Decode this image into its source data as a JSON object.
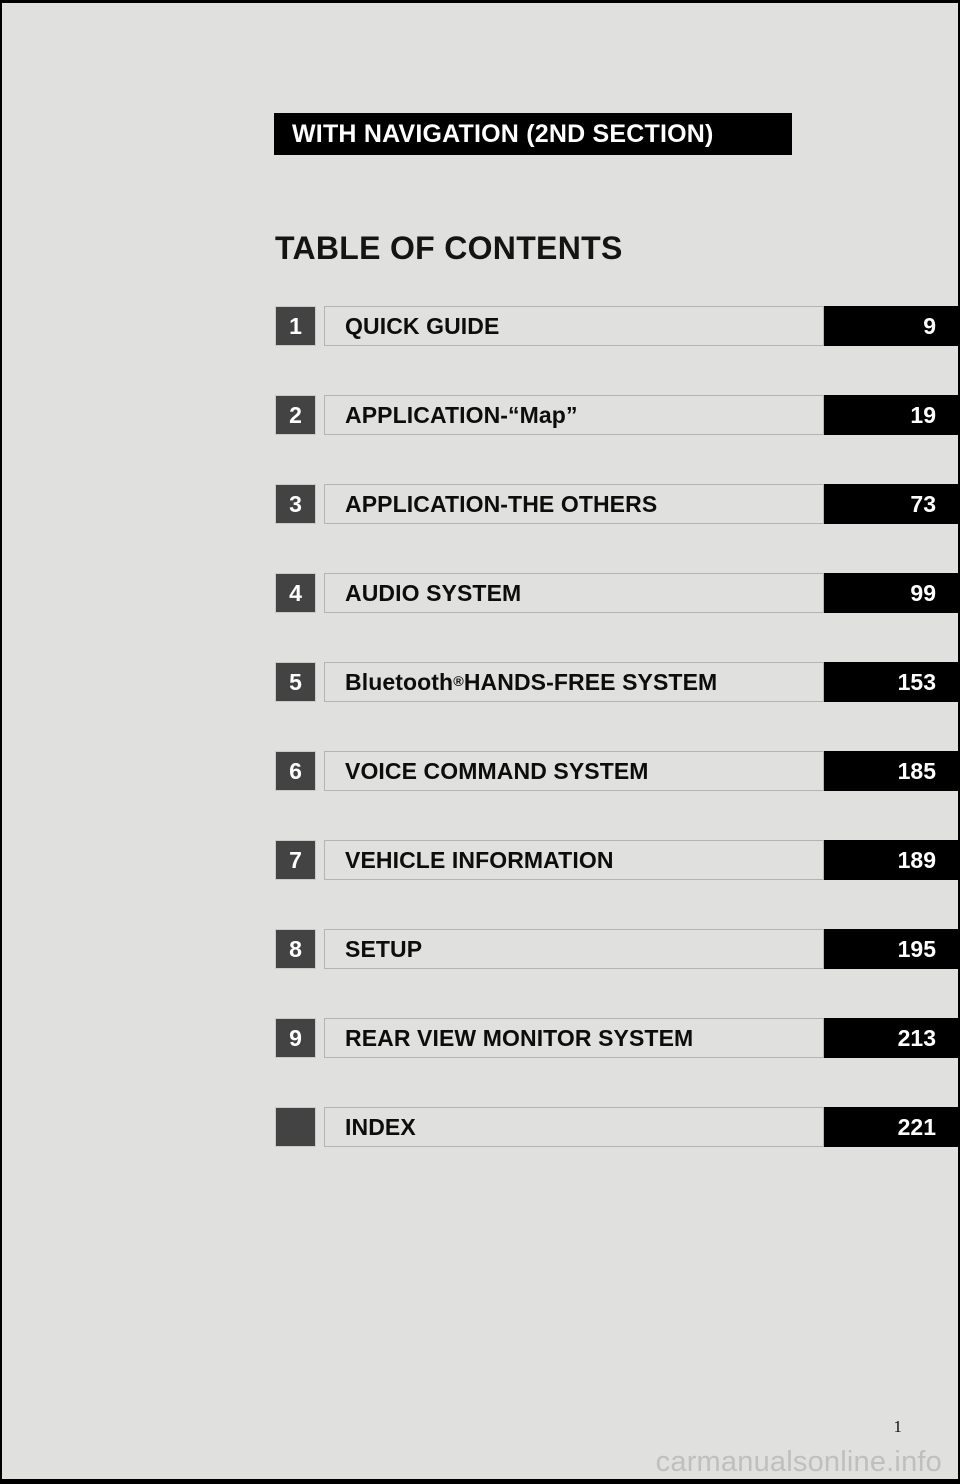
{
  "document": {
    "section_banner": "WITH NAVIGATION (2ND SECTION)",
    "page_title": "TABLE OF CONTENTS",
    "folio": "1",
    "watermark": "carmanualsonline.info"
  },
  "colors": {
    "page_background": "#e0e0de",
    "banner_background": "#000000",
    "banner_text": "#ffffff",
    "chapter_number_background": "#434343",
    "chapter_title_background": "#e0e0de",
    "chapter_page_background": "#000000",
    "watermark_text": "#bfbfbd"
  },
  "toc": {
    "entries": [
      {
        "number": "1",
        "title": "QUICK GUIDE",
        "title_suffix": "",
        "page": "9"
      },
      {
        "number": "2",
        "title": "APPLICATION-“Map”",
        "title_suffix": "",
        "page": "19"
      },
      {
        "number": "3",
        "title": "APPLICATION-THE OTHERS",
        "title_suffix": "",
        "page": "73"
      },
      {
        "number": "4",
        "title": "AUDIO SYSTEM",
        "title_suffix": "",
        "page": "99"
      },
      {
        "number": "5",
        "title": "Bluetooth",
        "title_superscript": "®",
        "title_suffix": " HANDS-FREE SYSTEM",
        "page": "153"
      },
      {
        "number": "6",
        "title": "VOICE COMMAND SYSTEM",
        "title_suffix": "",
        "page": "185"
      },
      {
        "number": "7",
        "title": "VEHICLE INFORMATION",
        "title_suffix": "",
        "page": "189"
      },
      {
        "number": "8",
        "title": "SETUP",
        "title_suffix": "",
        "page": "195"
      },
      {
        "number": "9",
        "title": "REAR VIEW MONITOR SYSTEM",
        "title_suffix": "",
        "page": "213"
      },
      {
        "number": "",
        "title": "INDEX",
        "title_suffix": "",
        "page": "221"
      }
    ]
  }
}
